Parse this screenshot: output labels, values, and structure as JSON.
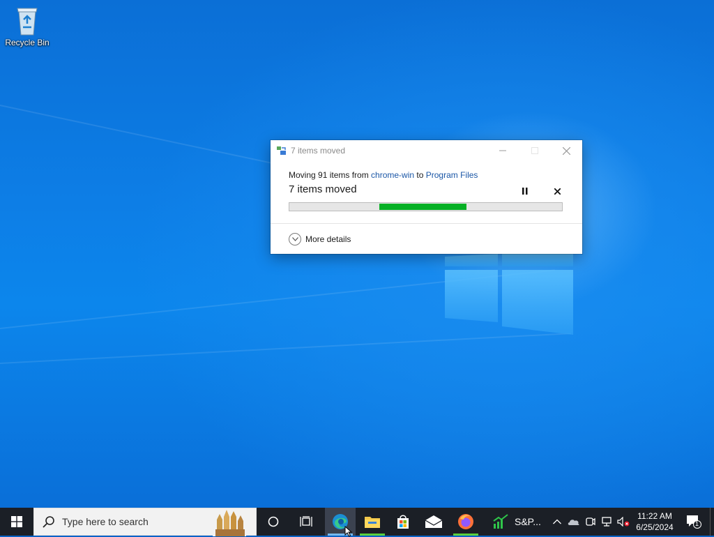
{
  "desktop": {
    "recycle_bin_label": "Recycle Bin"
  },
  "dialog": {
    "title": "7 items moved",
    "moving_prefix": "Moving 91 items from ",
    "source": "chrome-win",
    "to_word": " to ",
    "destination": "Program Files",
    "status": "7 items moved",
    "progress": {
      "start": 0.33,
      "end": 0.65
    },
    "more_details": "More details",
    "progress_color": "#06b025"
  },
  "taskbar": {
    "search_placeholder": "Type here to search",
    "stocks_label": "S&P...",
    "time": "11:22 AM",
    "date": "6/25/2024",
    "notification_count": "1",
    "pinned": [
      "start-icon",
      "cortana-icon",
      "task-view-icon",
      "edge-icon",
      "file-explorer-icon",
      "store-icon",
      "mail-icon",
      "firefox-icon",
      "stocks-icon"
    ],
    "tray": [
      "chevron-up-icon",
      "onedrive-icon",
      "meet-now-icon",
      "network-icon",
      "volume-muted-icon"
    ]
  }
}
